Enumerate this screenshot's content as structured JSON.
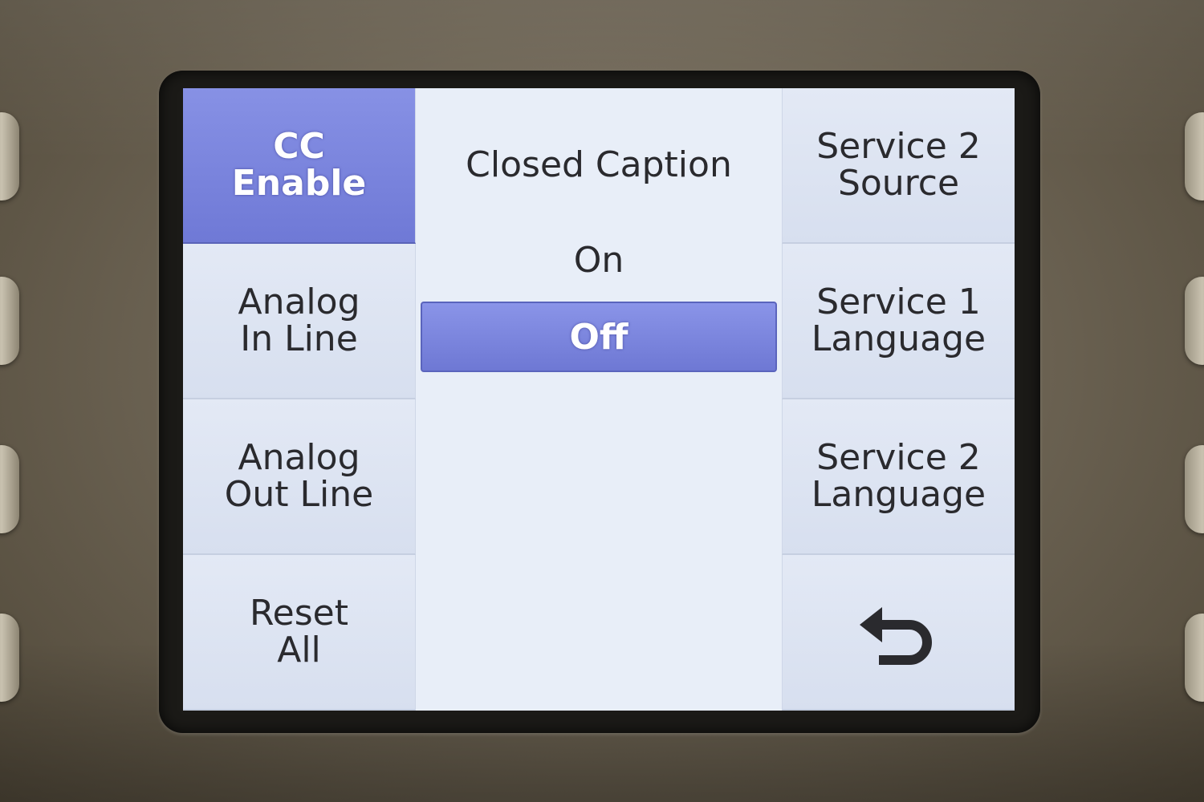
{
  "left_menu": [
    {
      "lines": [
        "CC",
        "Enable"
      ],
      "active": true
    },
    {
      "lines": [
        "Analog",
        "In Line"
      ],
      "active": false
    },
    {
      "lines": [
        "Analog",
        "Out Line"
      ],
      "active": false
    },
    {
      "lines": [
        "Reset",
        "All"
      ],
      "active": false
    }
  ],
  "panel": {
    "title": "Closed Caption",
    "options": [
      {
        "label": "On",
        "selected": false
      },
      {
        "label": "Off",
        "selected": true
      }
    ]
  },
  "right_menu": [
    {
      "lines": [
        "Service 2",
        "Source"
      ]
    },
    {
      "lines": [
        "Service 1",
        "Language"
      ]
    },
    {
      "lines": [
        "Service 2",
        "Language"
      ]
    },
    {
      "icon": "back-arrow-icon"
    }
  ],
  "colors": {
    "accent": "#7580dc",
    "screen_bg": "#e4ebf6",
    "text": "#2a2a2e"
  }
}
